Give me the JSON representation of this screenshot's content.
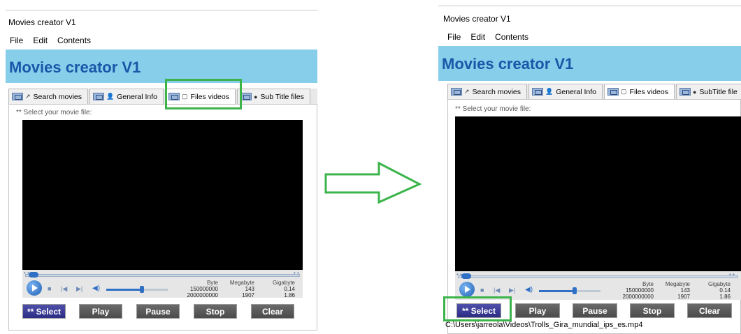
{
  "before": {
    "window_title": "Movies creator V1",
    "menu": [
      "File",
      "Edit",
      "Contents"
    ],
    "app_header": "Movies creator V1",
    "tabs": [
      "Search movies",
      "General Info",
      "Files videos",
      "Sub Title files"
    ],
    "active_tab": "Files videos",
    "hint": "** Select your movie file:",
    "sizes": {
      "headers": [
        "Byte",
        "Megabyte",
        "Gigabyte"
      ],
      "rows": [
        [
          "150000000",
          "143",
          "0.14"
        ],
        [
          "2000000000",
          "1907",
          "1.86"
        ]
      ]
    },
    "buttons": [
      "** Select",
      "Play",
      "Pause",
      "Stop",
      "Clear"
    ]
  },
  "after": {
    "window_title": "Movies creator V1",
    "menu": [
      "File",
      "Edit",
      "Contents"
    ],
    "app_header": "Movies creator V1",
    "tabs": [
      "Search movies",
      "General Info",
      "Files videos",
      "SubTitle file"
    ],
    "active_tab": "Files videos",
    "hint": "** Select your movie file:",
    "sizes": {
      "headers": [
        "Byte",
        "Megabyte",
        "Gigabyte"
      ],
      "rows": [
        [
          "150000000",
          "143",
          "0.14"
        ],
        [
          "2000000000",
          "1907",
          "1.86"
        ]
      ]
    },
    "buttons": [
      "** Select",
      "Play",
      "Pause",
      "Stop",
      "Clear"
    ],
    "file_path": "C:\\Users\\jarreola\\Videos\\Trolls_Gira_mundial_ips_es.mp4"
  },
  "colors": {
    "header_bg": "#87ceeb",
    "header_text": "#1a57a8",
    "highlight": "#3cb44b",
    "select_button": "#2c2e86"
  },
  "icons": {
    "arrow": "hollow-right-arrow-icon"
  }
}
